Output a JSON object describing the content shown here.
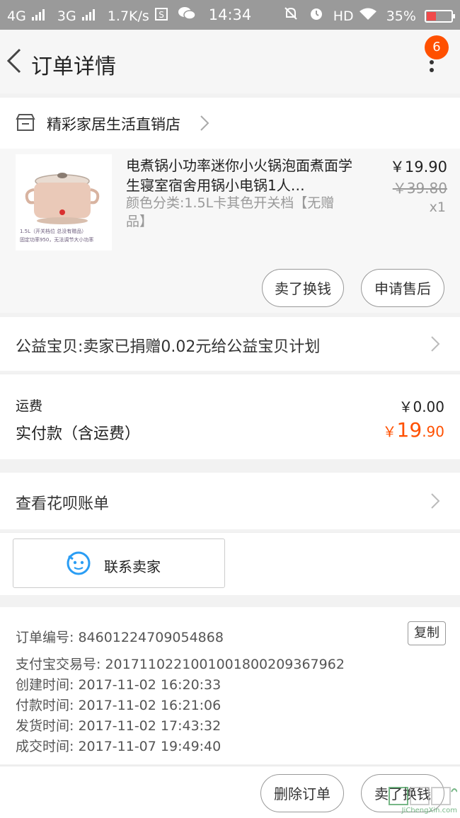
{
  "status_bar": {
    "signal_4g": "4G",
    "signal_3g": "3G",
    "speed": "1.7K/s",
    "time": "14:34",
    "network": "HD",
    "battery": "35%",
    "battery_level": 0.35,
    "icons": [
      "signal-icon",
      "s-icon",
      "wechat-icon",
      "mute-icon",
      "alarm-icon",
      "wifi-icon",
      "battery-icon"
    ]
  },
  "nav": {
    "title": "订单详情",
    "badge": "6"
  },
  "shop": {
    "name": "精彩家居生活直销店"
  },
  "item": {
    "title": "电煮锅小功率迷你小火锅泡面煮面学生寝室宿舍用锅小电锅1人…",
    "spec": "颜色分类:1.5L卡其色开关档【无赠品】",
    "price": "￥19.90",
    "original_price": "￥39.80",
    "quantity": "x1",
    "thumb_caption_1": "1.5L（开关档位 总没有赠品）",
    "thumb_caption_2": "固定功率950，无法调节大小功率",
    "btn_sell": "卖了换钱",
    "btn_after_sale": "申请售后"
  },
  "charity": {
    "text": "公益宝贝:卖家已捐赠0.02元给公益宝贝计划"
  },
  "payment": {
    "shipping_label": "运费",
    "shipping_value": "￥0.00",
    "paid_label": "实付款（含运费）",
    "paid_currency": "￥",
    "paid_integer": "19",
    "paid_decimal": ".90"
  },
  "huabei": {
    "text": "查看花呗账单"
  },
  "contact": {
    "label": "联系卖家"
  },
  "order_info": {
    "order_no": "订单编号: 84601224709054868",
    "alipay_no": "支付宝交易号: 2017110221001001800209367962",
    "created": "创建时间: 2017-11-02 16:20:33",
    "paid": "付款时间: 2017-11-02 16:21:06",
    "shipped": "发货时间: 2017-11-02 17:43:32",
    "completed": "成交时间: 2017-11-07 19:49:40",
    "copy_label": "复制"
  },
  "bottom": {
    "delete_label": "删除订单",
    "sell_label": "卖了换钱"
  },
  "watermark": {
    "text": "JiChengXin.com"
  },
  "colors": {
    "accent": "#ff5000",
    "statusbar": "#9a9a9a"
  }
}
